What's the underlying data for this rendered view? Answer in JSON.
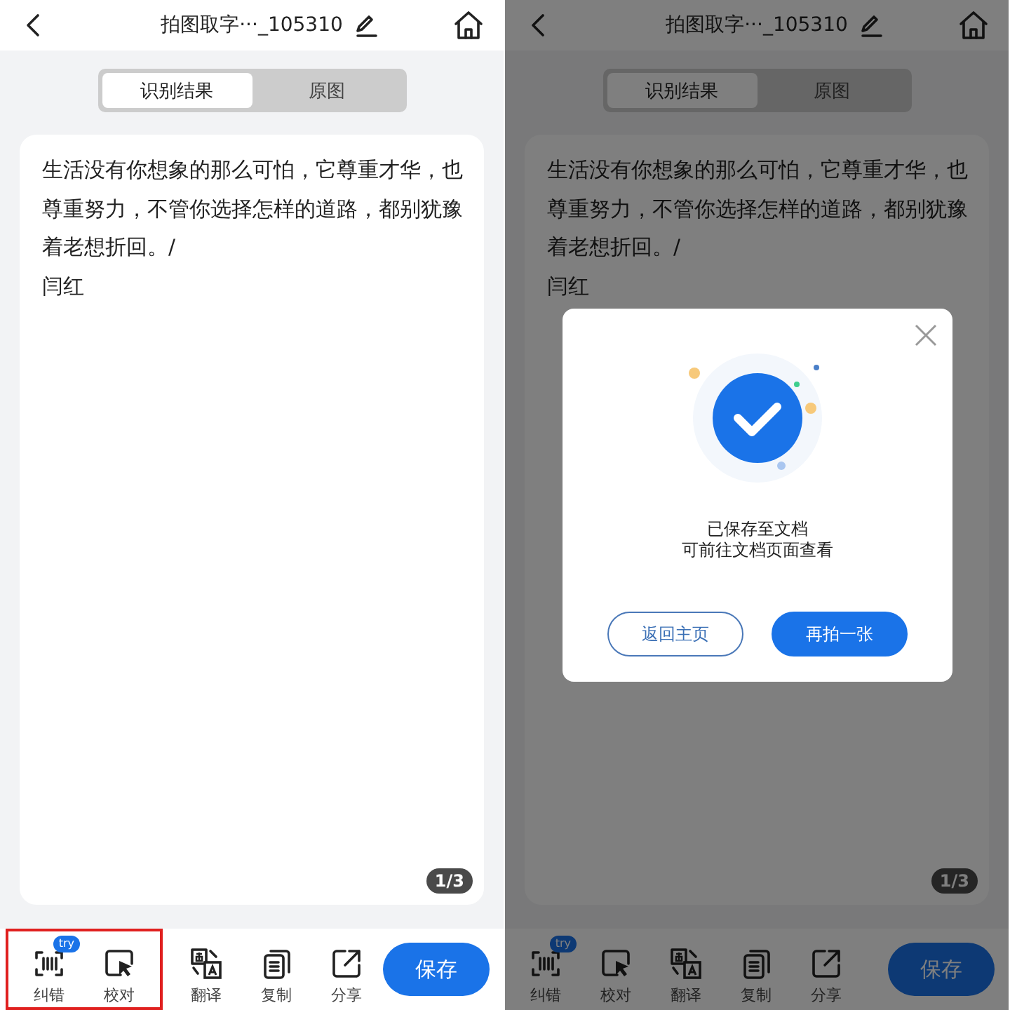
{
  "screens": [
    {
      "header": {
        "title": "拍图取字···_105310"
      },
      "tabs": [
        {
          "label": "识别结果",
          "selected": true
        },
        {
          "label": "原图",
          "selected": false
        }
      ],
      "text": "生活没有你想象的那么可怕，它尊重才华，也尊重努力，不管你选择怎样的道路，都别犹豫着老想折回。/\n闫红",
      "page_indicator": "1/3",
      "toolbar": [
        {
          "label": "纠错",
          "badge": "try",
          "highlighted": true
        },
        {
          "label": "校对",
          "highlighted": true
        },
        {
          "label": "翻译",
          "highlighted": false
        },
        {
          "label": "复制",
          "highlighted": false
        },
        {
          "label": "分享",
          "highlighted": false
        }
      ],
      "save_button": "保存"
    },
    {
      "header": {
        "title": "拍图取字···_105310"
      },
      "tabs": [
        {
          "label": "识别结果",
          "selected": true
        },
        {
          "label": "原图",
          "selected": false
        }
      ],
      "text": "生活没有你想象的那么可怕，它尊重才华，也尊重努力，不管你选择怎样的道路，都别犹豫着老想折回。/\n闫红",
      "page_indicator": "1/3",
      "toolbar": [
        {
          "label": "纠错",
          "badge": "try",
          "highlighted": false
        },
        {
          "label": "校对",
          "highlighted": false
        },
        {
          "label": "翻译",
          "highlighted": false
        },
        {
          "label": "复制",
          "highlighted": false
        },
        {
          "label": "分享",
          "highlighted": false
        }
      ],
      "save_button": "保存",
      "dialog": {
        "message": [
          "已保存至文档",
          "可前往文档页面查看"
        ],
        "buttons": [
          {
            "label": "返回主页",
            "primary": false
          },
          {
            "label": "再拍一张",
            "primary": true
          }
        ]
      }
    }
  ]
}
